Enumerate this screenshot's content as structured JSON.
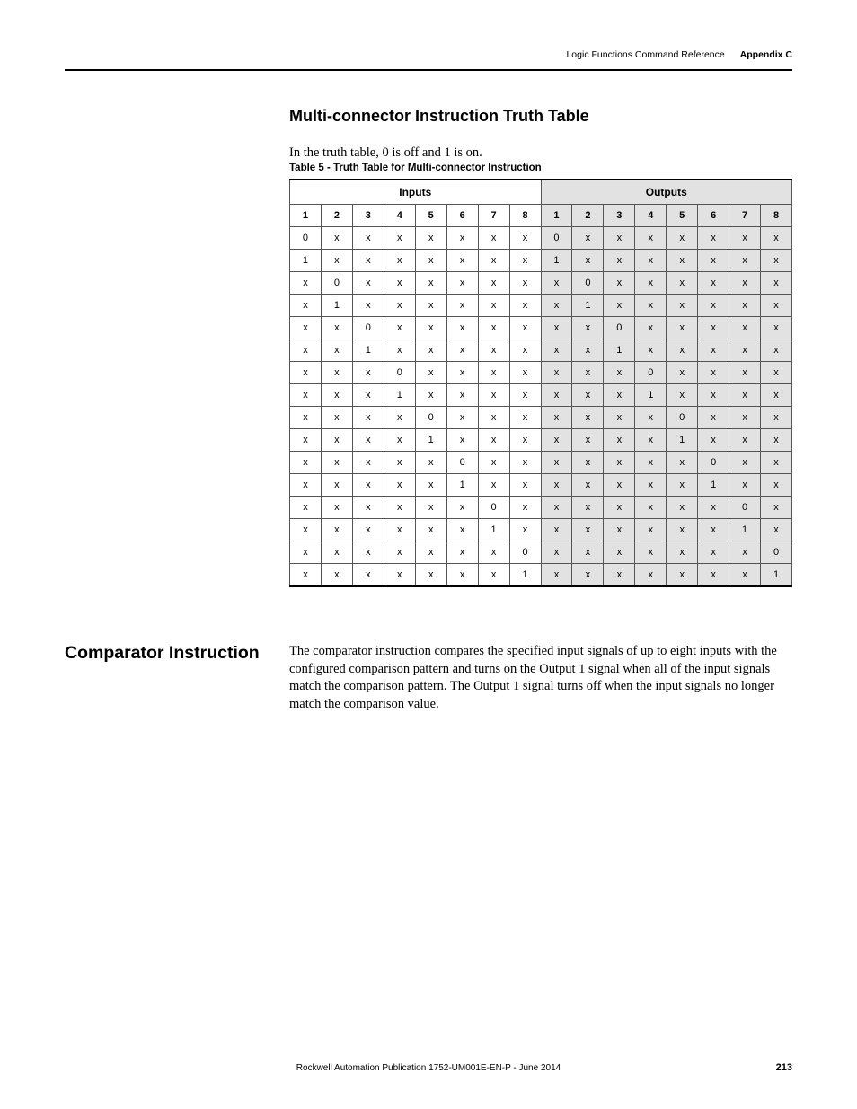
{
  "runningHead": {
    "section": "Logic Functions Command Reference",
    "appendix": "Appendix C"
  },
  "heading": "Multi-connector Instruction Truth Table",
  "introLine": "In the truth table, 0 is off and 1 is on.",
  "tableCaption": "Table 5 - Truth Table for Multi-connector Instruction",
  "groupHeaders": {
    "inputs": "Inputs",
    "outputs": "Outputs"
  },
  "colHeaders": [
    "1",
    "2",
    "3",
    "4",
    "5",
    "6",
    "7",
    "8",
    "1",
    "2",
    "3",
    "4",
    "5",
    "6",
    "7",
    "8"
  ],
  "chart_data": {
    "type": "table",
    "title": "Truth Table for Multi-connector Instruction",
    "columns": {
      "inputs": [
        "1",
        "2",
        "3",
        "4",
        "5",
        "6",
        "7",
        "8"
      ],
      "outputs": [
        "1",
        "2",
        "3",
        "4",
        "5",
        "6",
        "7",
        "8"
      ]
    },
    "rows": [
      {
        "inputs": [
          "0",
          "x",
          "x",
          "x",
          "x",
          "x",
          "x",
          "x"
        ],
        "outputs": [
          "0",
          "x",
          "x",
          "x",
          "x",
          "x",
          "x",
          "x"
        ]
      },
      {
        "inputs": [
          "1",
          "x",
          "x",
          "x",
          "x",
          "x",
          "x",
          "x"
        ],
        "outputs": [
          "1",
          "x",
          "x",
          "x",
          "x",
          "x",
          "x",
          "x"
        ]
      },
      {
        "inputs": [
          "x",
          "0",
          "x",
          "x",
          "x",
          "x",
          "x",
          "x"
        ],
        "outputs": [
          "x",
          "0",
          "x",
          "x",
          "x",
          "x",
          "x",
          "x"
        ]
      },
      {
        "inputs": [
          "x",
          "1",
          "x",
          "x",
          "x",
          "x",
          "x",
          "x"
        ],
        "outputs": [
          "x",
          "1",
          "x",
          "x",
          "x",
          "x",
          "x",
          "x"
        ]
      },
      {
        "inputs": [
          "x",
          "x",
          "0",
          "x",
          "x",
          "x",
          "x",
          "x"
        ],
        "outputs": [
          "x",
          "x",
          "0",
          "x",
          "x",
          "x",
          "x",
          "x"
        ]
      },
      {
        "inputs": [
          "x",
          "x",
          "1",
          "x",
          "x",
          "x",
          "x",
          "x"
        ],
        "outputs": [
          "x",
          "x",
          "1",
          "x",
          "x",
          "x",
          "x",
          "x"
        ]
      },
      {
        "inputs": [
          "x",
          "x",
          "x",
          "0",
          "x",
          "x",
          "x",
          "x"
        ],
        "outputs": [
          "x",
          "x",
          "x",
          "0",
          "x",
          "x",
          "x",
          "x"
        ]
      },
      {
        "inputs": [
          "x",
          "x",
          "x",
          "1",
          "x",
          "x",
          "x",
          "x"
        ],
        "outputs": [
          "x",
          "x",
          "x",
          "1",
          "x",
          "x",
          "x",
          "x"
        ]
      },
      {
        "inputs": [
          "x",
          "x",
          "x",
          "x",
          "0",
          "x",
          "x",
          "x"
        ],
        "outputs": [
          "x",
          "x",
          "x",
          "x",
          "0",
          "x",
          "x",
          "x"
        ]
      },
      {
        "inputs": [
          "x",
          "x",
          "x",
          "x",
          "1",
          "x",
          "x",
          "x"
        ],
        "outputs": [
          "x",
          "x",
          "x",
          "x",
          "1",
          "x",
          "x",
          "x"
        ]
      },
      {
        "inputs": [
          "x",
          "x",
          "x",
          "x",
          "x",
          "0",
          "x",
          "x"
        ],
        "outputs": [
          "x",
          "x",
          "x",
          "x",
          "x",
          "0",
          "x",
          "x"
        ]
      },
      {
        "inputs": [
          "x",
          "x",
          "x",
          "x",
          "x",
          "1",
          "x",
          "x"
        ],
        "outputs": [
          "x",
          "x",
          "x",
          "x",
          "x",
          "1",
          "x",
          "x"
        ]
      },
      {
        "inputs": [
          "x",
          "x",
          "x",
          "x",
          "x",
          "x",
          "0",
          "x"
        ],
        "outputs": [
          "x",
          "x",
          "x",
          "x",
          "x",
          "x",
          "0",
          "x"
        ]
      },
      {
        "inputs": [
          "x",
          "x",
          "x",
          "x",
          "x",
          "x",
          "1",
          "x"
        ],
        "outputs": [
          "x",
          "x",
          "x",
          "x",
          "x",
          "x",
          "1",
          "x"
        ]
      },
      {
        "inputs": [
          "x",
          "x",
          "x",
          "x",
          "x",
          "x",
          "x",
          "0"
        ],
        "outputs": [
          "x",
          "x",
          "x",
          "x",
          "x",
          "x",
          "x",
          "0"
        ]
      },
      {
        "inputs": [
          "x",
          "x",
          "x",
          "x",
          "x",
          "x",
          "x",
          "1"
        ],
        "outputs": [
          "x",
          "x",
          "x",
          "x",
          "x",
          "x",
          "x",
          "1"
        ]
      }
    ]
  },
  "subsection": {
    "title": "Comparator Instruction",
    "body": "The comparator instruction compares the specified input signals of up to eight inputs with the configured comparison pattern and turns on the Output 1 signal when all of the input signals match the comparison pattern. The Output 1 signal turns off when the input signals no longer match the comparison value."
  },
  "footer": {
    "publication": "Rockwell Automation Publication 1752-UM001E-EN-P - June 2014",
    "pageNumber": "213"
  }
}
